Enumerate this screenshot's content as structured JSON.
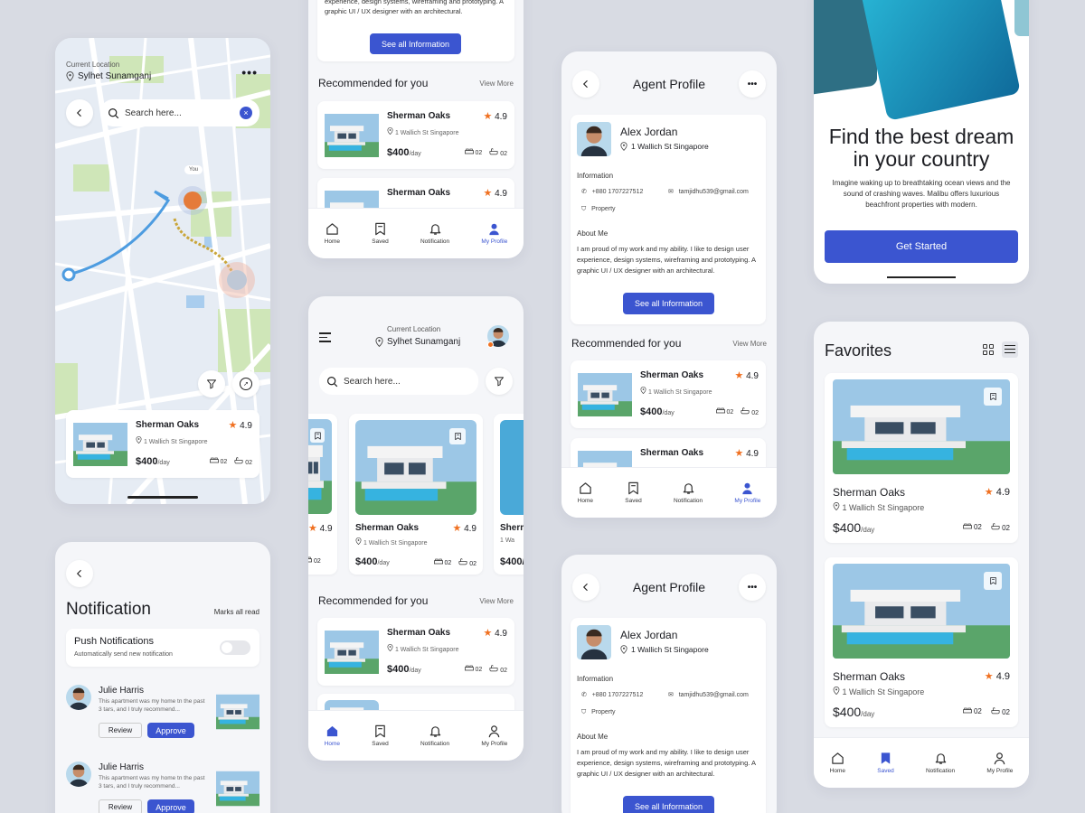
{
  "colors": {
    "accent": "#3b55d0",
    "star": "#f07020"
  },
  "map_screen": {
    "location_label": "Current Location",
    "location": "Sylhet Sunamganj",
    "search_placeholder": "Search here...",
    "you_label": "You",
    "card": {
      "name": "Sherman Oaks",
      "rating": "4.9",
      "address": "1 Wallich St Singapore",
      "price": "$400",
      "per": "/day",
      "beds": "02",
      "baths": "02"
    }
  },
  "top_center": {
    "about_text": "experience, design systems, wireframing and prototyping. A graphic UI / UX designer with an architectural.",
    "see_all": "See all Information",
    "section": "Recommended for you",
    "view_more": "View More",
    "items": [
      {
        "name": "Sherman Oaks",
        "rating": "4.9",
        "address": "1 Wallich St Singapore",
        "price": "$400",
        "per": "/day",
        "beds": "02",
        "baths": "02"
      },
      {
        "name": "Sherman Oaks",
        "rating": "4.9"
      }
    ],
    "nav": [
      "Home",
      "Saved",
      "Notification",
      "My Profile"
    ]
  },
  "home_screen": {
    "location_label": "Current Location",
    "location": "Sylhet Sunamganj",
    "search_placeholder": "Search here...",
    "carousel": [
      {
        "name": "",
        "rating": "4.9",
        "address": "",
        "price": "",
        "beds": "02",
        "baths": ""
      },
      {
        "name": "Sherman Oaks",
        "rating": "4.9",
        "address": "1 Wallich St Singapore",
        "price": "$400",
        "per": "/day",
        "beds": "02",
        "baths": "02"
      },
      {
        "name": "Sherm",
        "rating": "",
        "address": "1 Wa",
        "price": "$400/"
      }
    ],
    "section": "Recommended for you",
    "view_more": "View More",
    "items": [
      {
        "name": "Sherman Oaks",
        "rating": "4.9",
        "address": "1 Wallich St Singapore",
        "price": "$400",
        "per": "/day",
        "beds": "02",
        "baths": "02"
      }
    ],
    "nav": [
      "Home",
      "Saved",
      "Notification",
      "My Profile"
    ]
  },
  "agent1": {
    "title": "Agent Profile",
    "name": "Alex Jordan",
    "address": "1 Wallich St Singapore",
    "info_title": "Information",
    "phone": "+880 1707227512",
    "email": "tamjidhu539@gmail.com",
    "property": "Property",
    "about_title": "About Me",
    "about": "I am proud of my work and my ability. I like to design user experience, design systems, wireframing and prototyping. A graphic UI / UX designer with an architectural.",
    "see_all": "See all Information",
    "section": "Recommended for you",
    "view_more": "View More",
    "items": [
      {
        "name": "Sherman Oaks",
        "rating": "4.9",
        "address": "1 Wallich St Singapore",
        "price": "$400",
        "per": "/day",
        "beds": "02",
        "baths": "02"
      },
      {
        "name": "Sherman Oaks",
        "rating": "4.9"
      }
    ],
    "nav": [
      "Home",
      "Saved",
      "Notification",
      "My Profile"
    ]
  },
  "agent2": {
    "title": "Agent Profile",
    "name": "Alex Jordan",
    "address": "1 Wallich St Singapore",
    "info_title": "Information",
    "phone": "+880 1707227512",
    "email": "tamjidhu539@gmail.com",
    "property": "Property",
    "about_title": "About Me",
    "about": "I am proud of my work and my ability. I like to design user experience, design systems, wireframing and prototyping. A graphic UI / UX designer with an architectural.",
    "see_all": "See all Information"
  },
  "notification": {
    "title": "Notification",
    "mark_all": "Marks all read",
    "push_title": "Push Notifications",
    "push_sub": "Automatically send new notification",
    "items": [
      {
        "name": "Julie Harris",
        "text": "This apartment was my home tn the past 3 tars, and I truly recommend...",
        "review": "Review",
        "approve": "Approve"
      },
      {
        "name": "Julie Harris",
        "text": "This apartment was my home tn the past 3 tars, and I truly recommend...",
        "review": "Review",
        "approve": "Approve"
      }
    ]
  },
  "onboarding": {
    "headline_1": "Find the best dream",
    "headline_2": "in your country",
    "body": "Imagine waking up to breathtaking ocean views and the sound of crashing waves. Malibu offers luxurious beachfront properties with modern.",
    "cta": "Get Started"
  },
  "favorites": {
    "title": "Favorites",
    "items": [
      {
        "name": "Sherman Oaks",
        "rating": "4.9",
        "address": "1 Wallich St Singapore",
        "price": "$400",
        "per": "/day",
        "beds": "02",
        "baths": "02"
      },
      {
        "name": "Sherman Oaks",
        "rating": "4.9",
        "address": "1 Wallich St Singapore",
        "price": "$400",
        "per": "/day",
        "beds": "02",
        "baths": "02"
      }
    ],
    "nav": [
      "Home",
      "Saved",
      "Notification",
      "My Profile"
    ]
  }
}
